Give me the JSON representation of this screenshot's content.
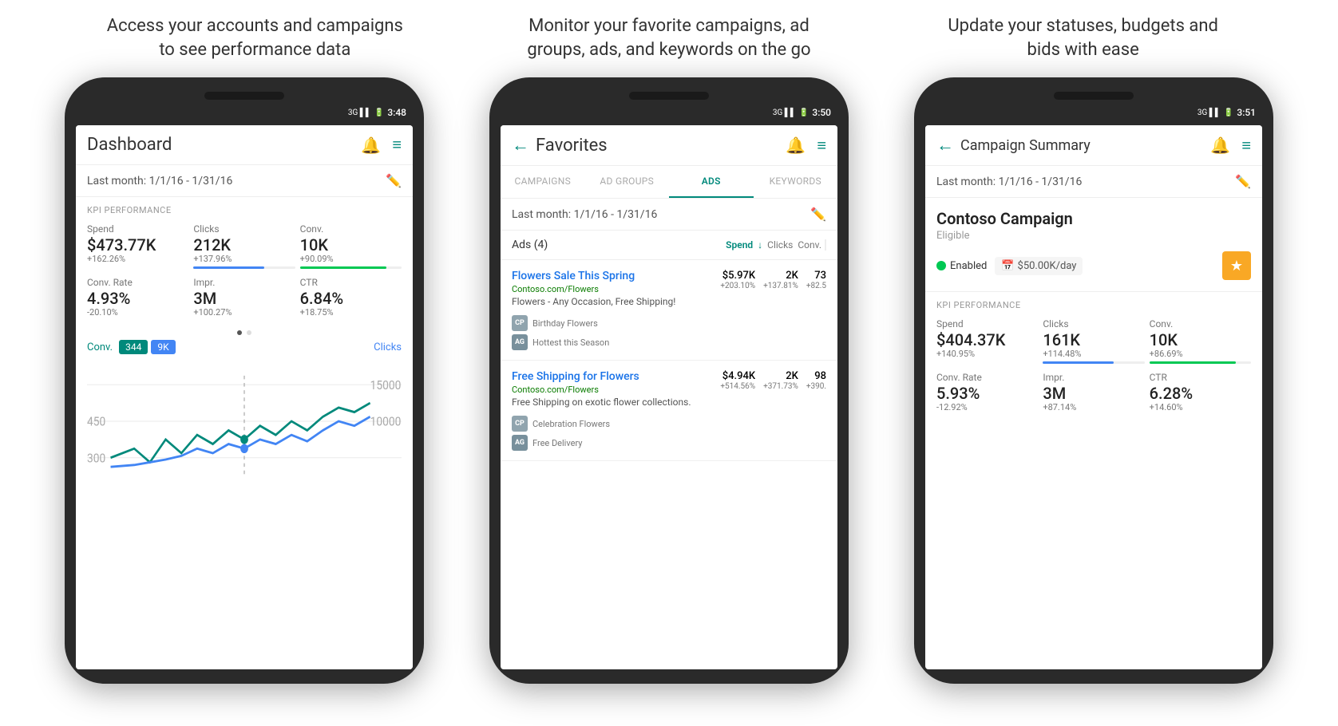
{
  "captions": [
    {
      "id": "caption-1",
      "text": "Access your accounts and campaigns\nto see performance data"
    },
    {
      "id": "caption-2",
      "text": "Monitor your favorite campaigns, ad\ngroups, ads, and keywords on the go"
    },
    {
      "id": "caption-3",
      "text": "Update your statuses, budgets and\nbids with ease"
    }
  ],
  "phone1": {
    "status_time": "3:48",
    "header_title": "Dashboard",
    "date_range": "Last month: 1/1/16 - 1/31/16",
    "kpi_label": "KPI PERFORMANCE",
    "kpi_items": [
      {
        "name": "Spend",
        "value": "$473.77K",
        "change": "+162.26%",
        "bar": null
      },
      {
        "name": "Clicks",
        "value": "212K",
        "change": "+137.96%",
        "bar": "blue"
      },
      {
        "name": "Conv.",
        "value": "10K",
        "change": "+90.09%",
        "bar": "green"
      },
      {
        "name": "Conv. Rate",
        "value": "4.93%",
        "change": "-20.10%",
        "bar": null
      },
      {
        "name": "Impr.",
        "value": "3M",
        "change": "+100.27%",
        "bar": null
      },
      {
        "name": "CTR",
        "value": "6.84%",
        "change": "+18.75%",
        "bar": null
      }
    ],
    "chart_conv_label": "Conv.",
    "chart_clicks_label": "Clicks",
    "chart_bubble_conv": "344",
    "chart_bubble_clicks": "9K"
  },
  "phone2": {
    "status_time": "3:50",
    "header_title": "Favorites",
    "date_range": "Last month: 1/1/16 - 1/31/16",
    "tabs": [
      "CAMPAIGNS",
      "AD GROUPS",
      "ADS",
      "KEYWORDS"
    ],
    "active_tab": "ADS",
    "ads_count": "Ads (4)",
    "col_spend": "Spend",
    "col_clicks": "Clicks",
    "col_conv": "Conv.",
    "ads": [
      {
        "title": "Flowers Sale This Spring",
        "url": "Contoso.com/Flowers",
        "desc": "Flowers - Any Occasion, Free Shipping!",
        "spend": "$5.97K",
        "spend_change": "+203.10%",
        "clicks": "2K",
        "clicks_change": "+137.81%",
        "conv": "73",
        "conv_change": "+82.5",
        "tags": [
          {
            "type": "CP",
            "label": "Birthday Flowers"
          },
          {
            "type": "AG",
            "label": "Hottest this Season"
          }
        ]
      },
      {
        "title": "Free Shipping for Flowers",
        "url": "Contoso.com/Flowers",
        "desc": "Free Shipping on exotic flower collections.",
        "spend": "$4.94K",
        "spend_change": "+514.56%",
        "clicks": "2K",
        "clicks_change": "+371.73%",
        "conv": "98",
        "conv_change": "+390.",
        "tags": [
          {
            "type": "CP",
            "label": "Celebration Flowers"
          },
          {
            "type": "AG",
            "label": "Free Delivery"
          }
        ]
      }
    ]
  },
  "phone3": {
    "status_time": "3:51",
    "header_title": "Campaign Summary",
    "date_range": "Last month: 1/1/16 - 1/31/16",
    "campaign_name": "Contoso Campaign",
    "campaign_status": "Eligible",
    "enabled_label": "Enabled",
    "budget": "$50.00K/day",
    "kpi_label": "KPI PERFORMANCE",
    "kpi_items": [
      {
        "name": "Spend",
        "value": "$404.37K",
        "change": "+140.95%",
        "bar": null
      },
      {
        "name": "Clicks",
        "value": "161K",
        "change": "+114.48%",
        "bar": "blue"
      },
      {
        "name": "Conv.",
        "value": "10K",
        "change": "+86.69%",
        "bar": "green"
      },
      {
        "name": "Conv. Rate",
        "value": "5.93%",
        "change": "-12.92%",
        "bar": null
      },
      {
        "name": "Impr.",
        "value": "3M",
        "change": "+87.14%",
        "bar": null
      },
      {
        "name": "CTR",
        "value": "6.28%",
        "change": "+14.60%",
        "bar": null
      }
    ]
  }
}
